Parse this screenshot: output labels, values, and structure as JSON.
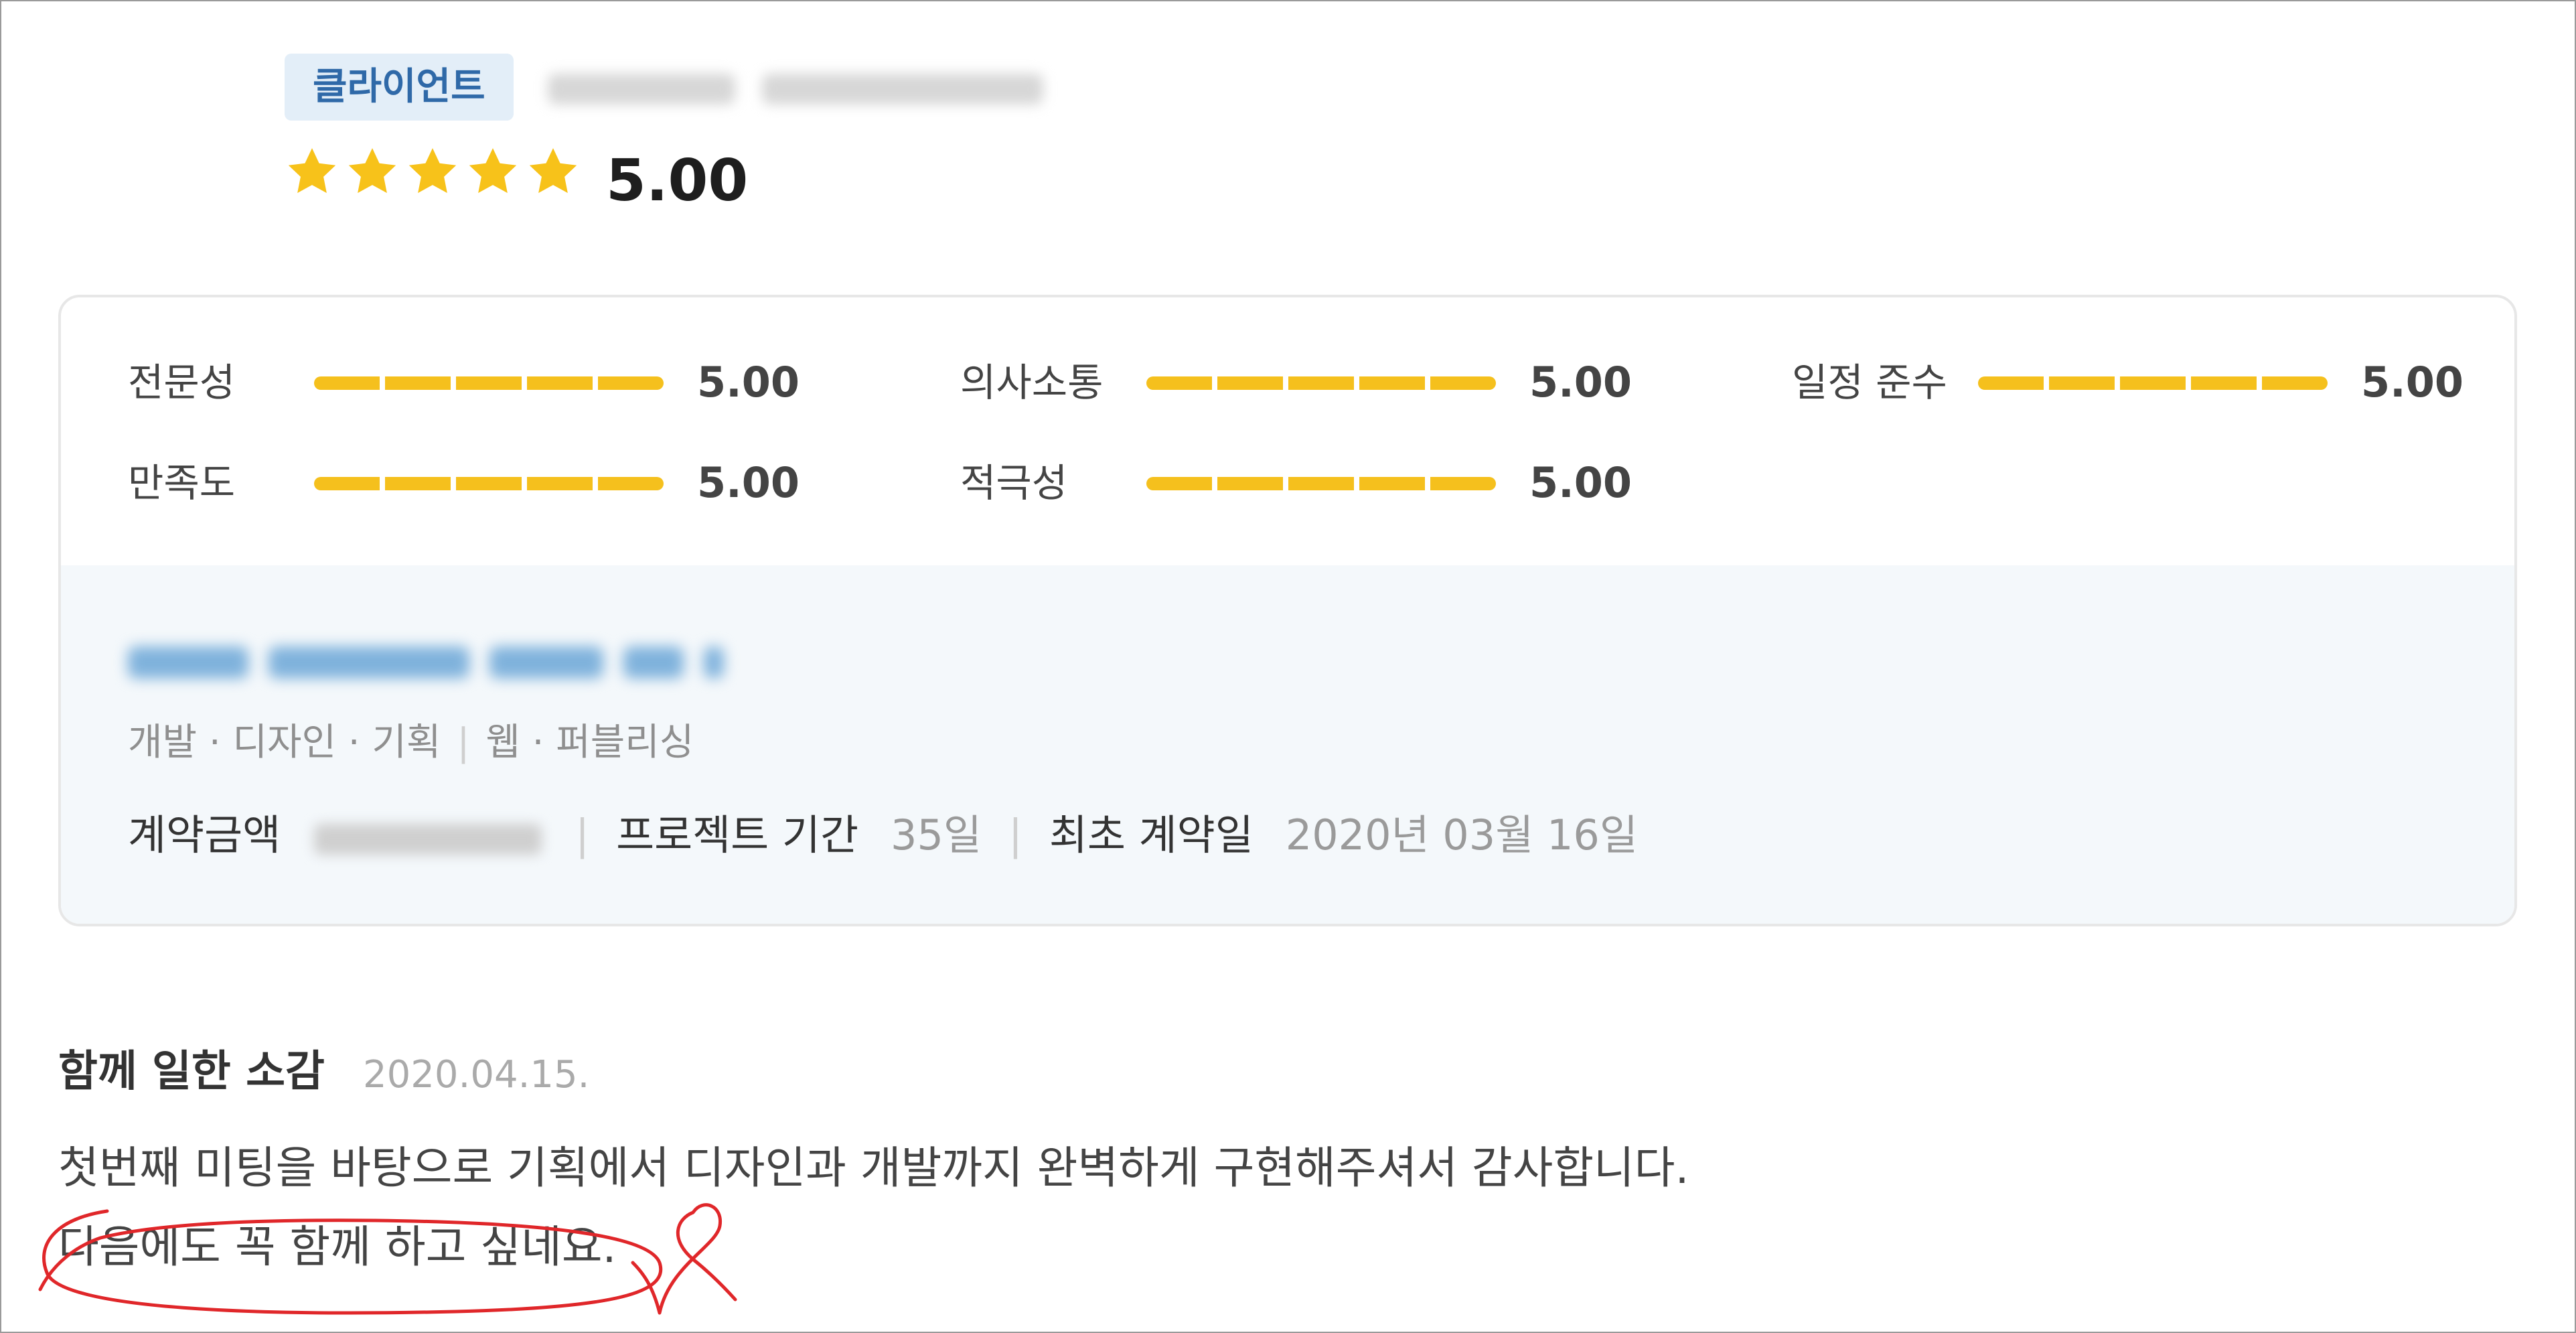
{
  "header": {
    "badge": "클라이언트",
    "rating": "5.00",
    "stars_filled": 5,
    "stars_total": 5
  },
  "metrics": [
    {
      "label": "전문성",
      "value": "5.00"
    },
    {
      "label": "의사소통",
      "value": "5.00"
    },
    {
      "label": "일정 준수",
      "value": "5.00"
    },
    {
      "label": "만족도",
      "value": "5.00"
    },
    {
      "label": "적극성",
      "value": "5.00"
    }
  ],
  "project": {
    "category_primary": "개발 · 디자인 · 기획",
    "category_secondary": "웹 · 퍼블리싱",
    "contract_amount_label": "계약금액",
    "period_label": "프로젝트 기간",
    "period_value": "35일",
    "first_contract_label": "최초 계약일",
    "first_contract_value": "2020년 03월 16일"
  },
  "review": {
    "heading": "함께 일한 소감",
    "date": "2020.04.15.",
    "line1": "첫번째 미팅을 바탕으로 기획에서 디자인과 개발까지 완벽하게 구현해주셔서 감사합니다.",
    "line2": "다음에도 꼭 함께 하고 싶네요."
  },
  "colors": {
    "star": "#f7c21a",
    "bar": "#f5c01d",
    "badge_bg": "#e3eef8",
    "badge_text": "#2f69a8",
    "panel_bg": "#f4f8fb",
    "annotation": "#e0272a"
  }
}
